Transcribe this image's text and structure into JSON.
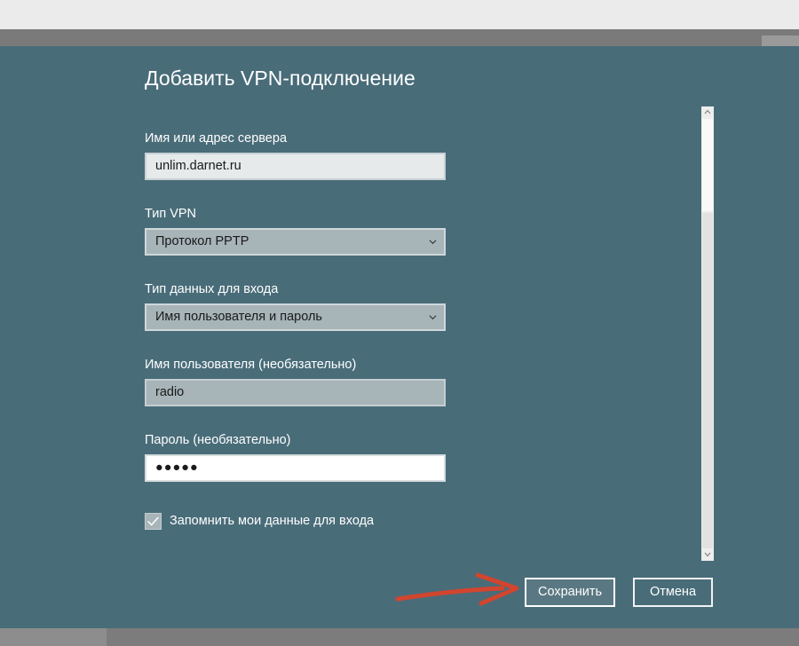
{
  "dialog": {
    "title": "Добавить VPN-подключение",
    "fields": {
      "server": {
        "label": "Имя или адрес сервера",
        "value": "unlim.darnet.ru"
      },
      "vpn_type": {
        "label": "Тип VPN",
        "value": "Протокол PPTP"
      },
      "signin_type": {
        "label": "Тип данных для входа",
        "value": "Имя пользователя и пароль"
      },
      "username": {
        "label": "Имя пользователя (необязательно)",
        "value": "radio"
      },
      "password": {
        "label": "Пароль (необязательно)",
        "value": "●●●●●"
      }
    },
    "remember": {
      "label": "Запомнить мои данные для входа",
      "checked": true
    },
    "buttons": {
      "save": "Сохранить",
      "cancel": "Отмена"
    }
  },
  "icons": {
    "vpn_type_dropdown": "chevron-down-icon",
    "signin_type_dropdown": "chevron-down-icon",
    "remember_checkbox": "checkmark-icon",
    "annotation": "red-arrow-icon"
  },
  "colors": {
    "dialog_background": "#496c79",
    "annotation_arrow": "#d2452e"
  }
}
